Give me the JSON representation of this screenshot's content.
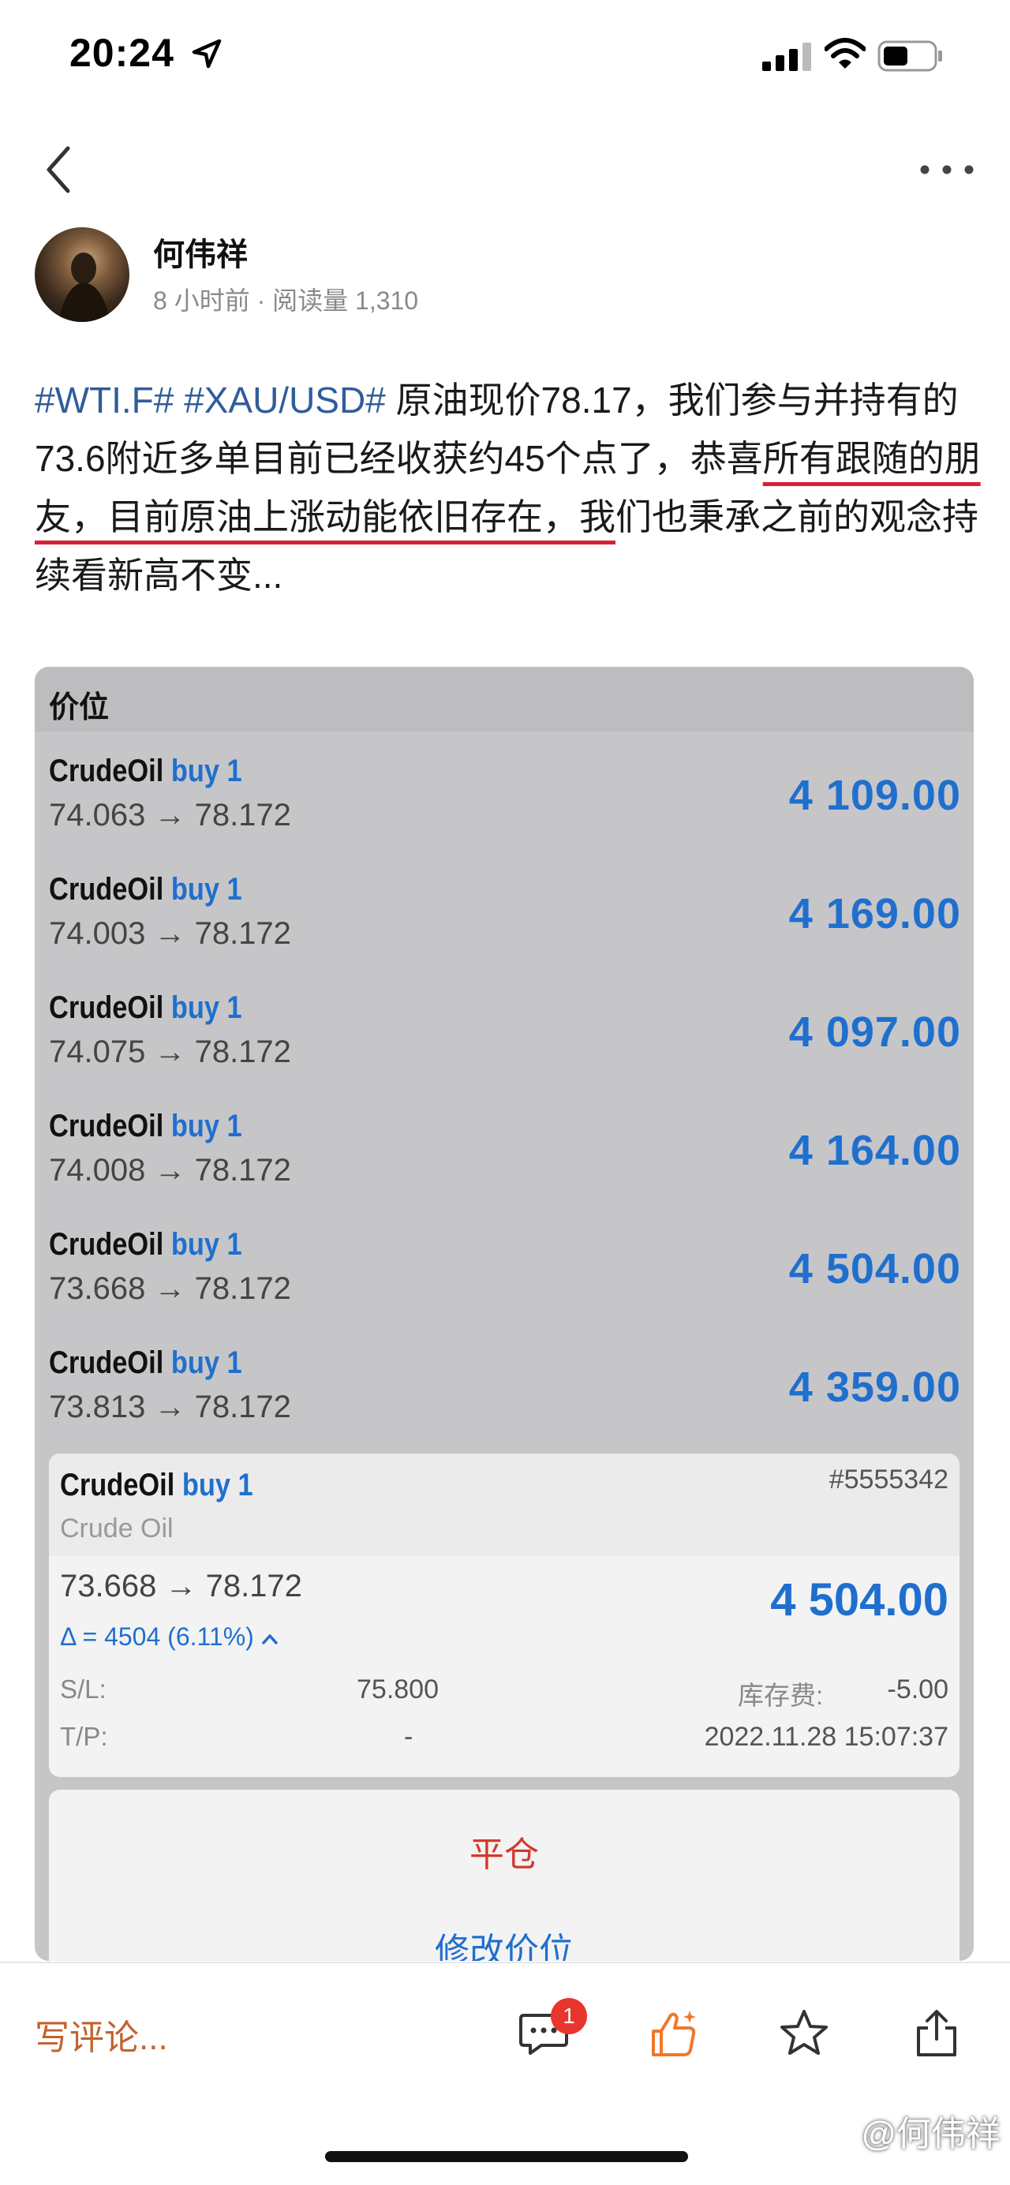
{
  "status_bar": {
    "time": "20:24"
  },
  "author": {
    "name": "何伟祥",
    "meta": "8 小时前 · 阅读量 1,310"
  },
  "post": {
    "tag1": "#WTI.F#",
    "tag2": "#XAU/USD#",
    "text_a": " 原油现价78.17，我们参与并持有的73.6附近多单目前已经收获约45个点了，恭喜",
    "text_underlined": "所有跟随的朋友，目前原油上涨动能依旧存在，我",
    "text_b": "们也秉承之前的观念持续看新高不变..."
  },
  "screenshot": {
    "header": "价位",
    "positions": [
      {
        "symbol": "CrudeOil",
        "side": "buy 1",
        "prices": "74.063 → 78.172",
        "profit": "4 109.00"
      },
      {
        "symbol": "CrudeOil",
        "side": "buy 1",
        "prices": "74.003 → 78.172",
        "profit": "4 169.00"
      },
      {
        "symbol": "CrudeOil",
        "side": "buy 1",
        "prices": "74.075 → 78.172",
        "profit": "4 097.00"
      },
      {
        "symbol": "CrudeOil",
        "side": "buy 1",
        "prices": "74.008 → 78.172",
        "profit": "4 164.00"
      },
      {
        "symbol": "CrudeOil",
        "side": "buy 1",
        "prices": "73.668 → 78.172",
        "profit": "4 504.00"
      },
      {
        "symbol": "CrudeOil",
        "side": "buy 1",
        "prices": "73.813 → 78.172",
        "profit": "4 359.00"
      }
    ],
    "detail": {
      "symbol": "CrudeOil",
      "side": "buy 1",
      "subtitle": "Crude Oil",
      "order": "#5555342",
      "prices": "73.668 → 78.172",
      "profit": "4 504.00",
      "delta": "Δ = 4504 (6.11%)",
      "sl_label": "S/L:",
      "sl_value": "75.800",
      "tp_label": "T/P:",
      "tp_value": "-",
      "swap_label": "库存费:",
      "swap_value": "-5.00",
      "time": "2022.11.28 15:07:37"
    },
    "actions": {
      "close": "平仓",
      "modify": "修改价位"
    }
  },
  "bottom_bar": {
    "comment_placeholder": "写评论...",
    "comment_badge": "1",
    "watermark": "@何伟祥"
  },
  "colors": {
    "tag": "#2f5d9b",
    "buy": "#1f6fce",
    "close": "#d23a2c",
    "underline": "#d92037",
    "comment": "#c2632d"
  },
  "icons": [
    "location-arrow-icon",
    "signal-icon",
    "wifi-icon",
    "battery-icon",
    "back-chevron-icon",
    "more-icon",
    "comment-icon",
    "like-icon",
    "star-icon",
    "share-icon"
  ]
}
